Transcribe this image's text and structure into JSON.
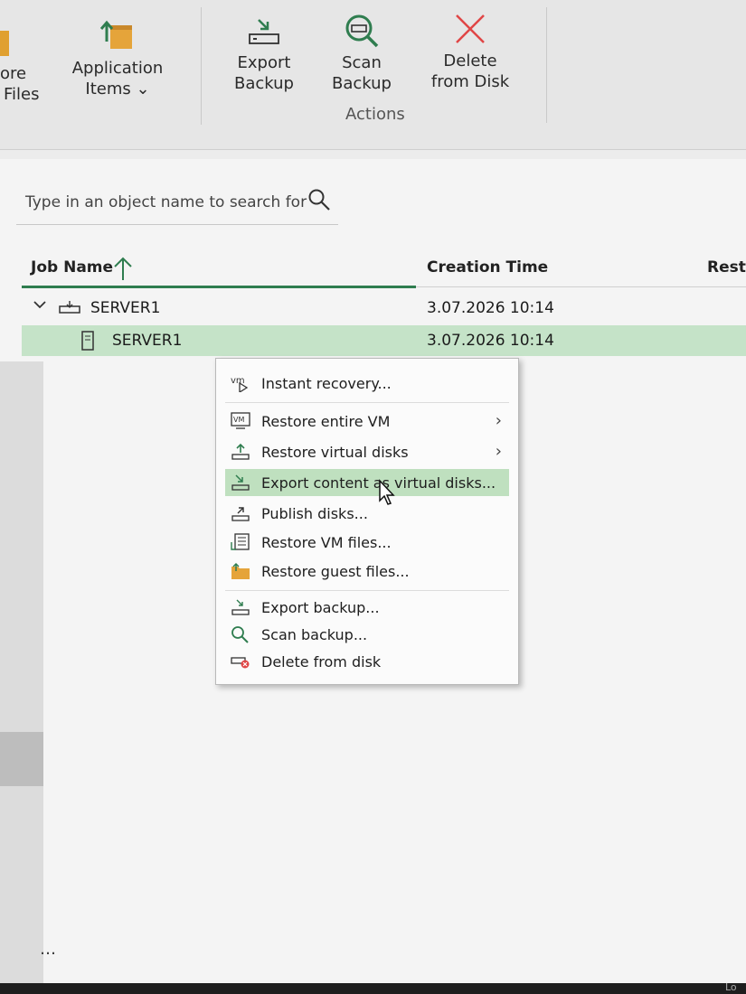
{
  "ribbon": {
    "restore_files": {
      "line1": "ore",
      "line2": "Files"
    },
    "application_items": {
      "line1": "Application",
      "line2": "Items"
    },
    "export_backup": {
      "line1": "Export",
      "line2": "Backup"
    },
    "scan_backup": {
      "line1": "Scan",
      "line2": "Backup"
    },
    "delete_from_disk": {
      "line1": "Delete",
      "line2": "from Disk"
    },
    "actions_group_label": "Actions"
  },
  "search": {
    "placeholder": "Type in an object name to search for"
  },
  "table": {
    "columns": [
      "Job Name",
      "Creation Time",
      "Resto"
    ],
    "rows": [
      {
        "name": "SERVER1",
        "creation_time": "3.07.2026 10:14",
        "level": 0
      },
      {
        "name": "SERVER1",
        "creation_time": "3.07.2026 10:14",
        "level": 1,
        "selected": true
      }
    ]
  },
  "context_menu": {
    "items": [
      {
        "label": "Instant recovery...",
        "icon": "vm-icon"
      },
      {
        "label": "Restore entire VM",
        "icon": "vm-box-icon",
        "submenu": true
      },
      {
        "label": "Restore virtual disks",
        "icon": "upload-disk-icon",
        "submenu": true
      },
      {
        "label": "Export content as virtual disks...",
        "icon": "export-disk-icon",
        "highlighted": true
      },
      {
        "label": "Publish disks...",
        "icon": "publish-disk-icon"
      },
      {
        "label": "Restore VM files...",
        "icon": "vm-files-icon"
      },
      {
        "label": "Restore guest files...",
        "icon": "folder-icon"
      },
      {
        "label": "Export backup...",
        "icon": "export-backup-icon"
      },
      {
        "label": "Scan backup...",
        "icon": "search-icon"
      },
      {
        "label": "Delete from disk",
        "icon": "delete-disk-icon"
      }
    ]
  },
  "bottom_text": "Lo",
  "colors": {
    "accent": "#2f7d4f",
    "selection": "#c5e3c8",
    "delete_red": "#e04646"
  }
}
